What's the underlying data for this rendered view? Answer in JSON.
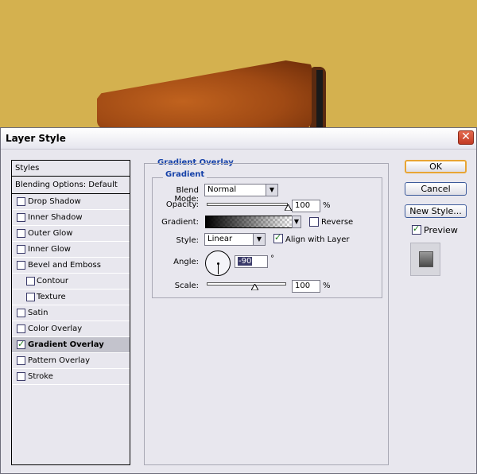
{
  "dialog": {
    "title": "Layer Style",
    "close_icon": "close-x-icon"
  },
  "styles_list": {
    "header": "Styles",
    "blending_options": "Blending Options: Default",
    "items": [
      {
        "label": "Drop Shadow",
        "checked": false,
        "indent": false,
        "selected": false
      },
      {
        "label": "Inner Shadow",
        "checked": false,
        "indent": false,
        "selected": false
      },
      {
        "label": "Outer Glow",
        "checked": false,
        "indent": false,
        "selected": false
      },
      {
        "label": "Inner Glow",
        "checked": false,
        "indent": false,
        "selected": false
      },
      {
        "label": "Bevel and Emboss",
        "checked": false,
        "indent": false,
        "selected": false
      },
      {
        "label": "Contour",
        "checked": false,
        "indent": true,
        "selected": false
      },
      {
        "label": "Texture",
        "checked": false,
        "indent": true,
        "selected": false
      },
      {
        "label": "Satin",
        "checked": false,
        "indent": false,
        "selected": false
      },
      {
        "label": "Color Overlay",
        "checked": false,
        "indent": false,
        "selected": false
      },
      {
        "label": "Gradient Overlay",
        "checked": true,
        "indent": false,
        "selected": true
      },
      {
        "label": "Pattern Overlay",
        "checked": false,
        "indent": false,
        "selected": false
      },
      {
        "label": "Stroke",
        "checked": false,
        "indent": false,
        "selected": false
      }
    ]
  },
  "gradient_overlay": {
    "section_title": "Gradient Overlay",
    "group_title": "Gradient",
    "blend_mode_label": "Blend Mode:",
    "blend_mode_value": "Normal",
    "opacity_label": "Opacity:",
    "opacity_value": "100",
    "opacity_unit": "%",
    "opacity_fraction": 1.0,
    "gradient_label": "Gradient:",
    "reverse_label": "Reverse",
    "reverse_checked": false,
    "style_label": "Style:",
    "style_value": "Linear",
    "align_label": "Align with Layer",
    "align_checked": true,
    "angle_label": "Angle:",
    "angle_value": "-90",
    "angle_unit": "°",
    "scale_label": "Scale:",
    "scale_value": "100",
    "scale_unit": "%",
    "scale_fraction": 0.6
  },
  "buttons": {
    "ok": "OK",
    "cancel": "Cancel",
    "new_style": "New Style...",
    "preview_label": "Preview",
    "preview_checked": true
  },
  "colors": {
    "canvas_background": "#d4b14f",
    "section_title": "#1440a8",
    "default_button_border": "#e8a534"
  }
}
